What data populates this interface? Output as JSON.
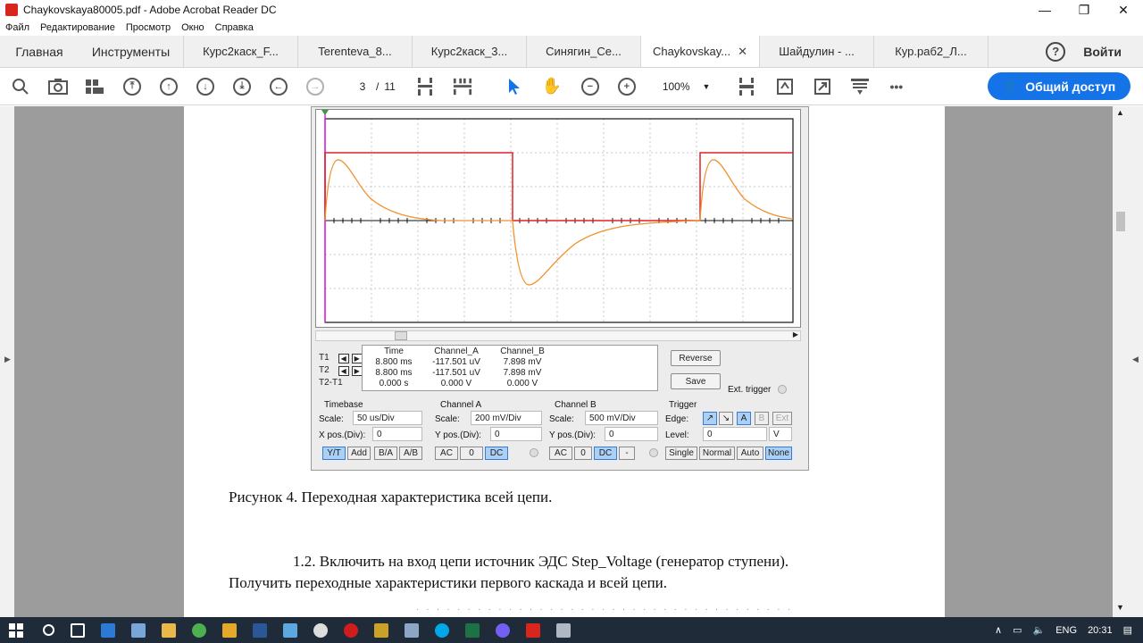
{
  "window": {
    "title": "Chaykovskaya80005.pdf - Adobe Acrobat Reader DC",
    "controls": {
      "minimize": "—",
      "maximize": "❐",
      "close": "✕"
    }
  },
  "menu": [
    "Файл",
    "Редактирование",
    "Просмотр",
    "Окно",
    "Справка"
  ],
  "tabs": {
    "home": "Главная",
    "tools": "Инструменты",
    "docs": [
      "Курс2каск_F...",
      "Terenteva_8...",
      "Курс2каск_3...",
      "Синягин_Се...",
      "Chaykovskay...",
      "Шайдулин - ...",
      "Кур.раб2_Л..."
    ],
    "active_index": 4,
    "close": "✕",
    "login": "Войти",
    "help": "?"
  },
  "toolbar": {
    "page_current": "3",
    "page_sep": "/",
    "page_total": "11",
    "zoom": "100%",
    "more": "•••",
    "share": "Общий доступ"
  },
  "oscilloscope": {
    "labels": {
      "t1": "T1",
      "t2": "T2",
      "t2t1": "T2-T1"
    },
    "headers": {
      "time": "Time",
      "channel_a": "Channel_A",
      "channel_b": "Channel_B"
    },
    "rows": [
      {
        "time": "8.800 ms",
        "a": "-117.501 uV",
        "b": "7.898 mV"
      },
      {
        "time": "8.800 ms",
        "a": "-117.501 uV",
        "b": "7.898 mV"
      },
      {
        "time": "0.000 s",
        "a": "0.000 V",
        "b": "0.000 V"
      }
    ],
    "reverse": "Reverse",
    "save": "Save",
    "ext_trigger": "Ext. trigger",
    "timebase": {
      "title": "Timebase",
      "scale_label": "Scale:",
      "scale": "50 us/Div",
      "xpos_label": "X pos.(Div):",
      "xpos": "0",
      "buttons": [
        "Y/T",
        "Add",
        "B/A",
        "A/B"
      ]
    },
    "channel_a": {
      "title": "Channel A",
      "scale_label": "Scale:",
      "scale": "200 mV/Div",
      "ypos_label": "Y pos.(Div):",
      "ypos": "0",
      "buttons": [
        "AC",
        "0",
        "DC"
      ]
    },
    "channel_b": {
      "title": "Channel B",
      "scale_label": "Scale:",
      "scale": "500 mV/Div",
      "ypos_label": "Y pos.(Div):",
      "ypos": "0",
      "buttons": [
        "AC",
        "0",
        "DC",
        "-"
      ]
    },
    "trigger": {
      "title": "Trigger",
      "edge_label": "Edge:",
      "edge_buttons": [
        "↗",
        "↘",
        "A",
        "B",
        "Ext"
      ],
      "level_label": "Level:",
      "level": "0",
      "level_unit": "V",
      "mode_buttons": [
        "Single",
        "Normal",
        "Auto",
        "None"
      ]
    }
  },
  "caption": "Рисунок 4. Переходная характеристика всей цепи.",
  "paragraph": {
    "line1": "1.2.  Включить на вход цепи источник ЭДС Step_Voltage (генератор ступени).",
    "line2": "Получить  переходные  характеристики  первого  каскада и всей цепи."
  },
  "taskbar": {
    "lang": "ENG",
    "time": "20:31"
  },
  "colors": {
    "accent": "#1473e6",
    "trace_red": "#e0202a",
    "trace_orange": "#f0922e",
    "cursor_magenta": "#e020e0"
  }
}
